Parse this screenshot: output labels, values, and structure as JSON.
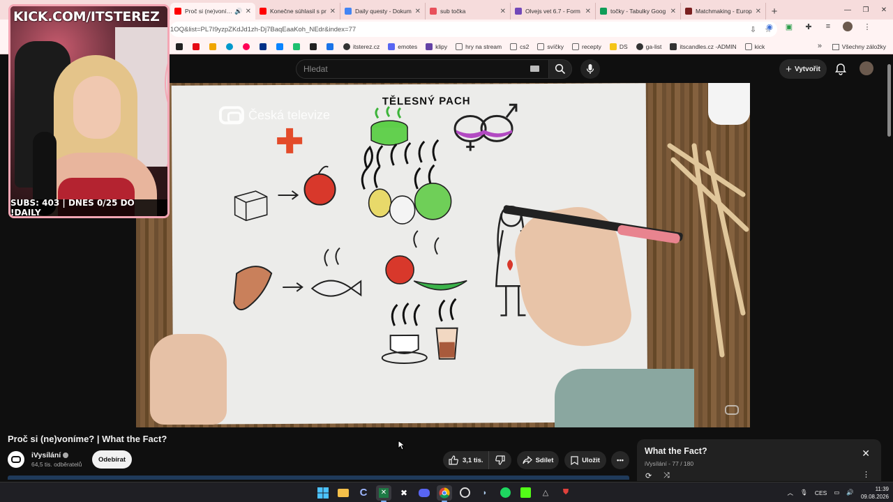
{
  "browser": {
    "tabs": [
      {
        "title": "Proč si (ne)voníme? | What the Fact?",
        "favicon_color": "#ff0000",
        "active": true
      },
      {
        "title": "Konečne súhlasil s pr",
        "favicon_color": "#ff0000"
      },
      {
        "title": "Daily questy - Dokum",
        "favicon_color": "#4285f4"
      },
      {
        "title": "sub točka",
        "favicon_color": "#e8505b"
      },
      {
        "title": "Olvejs vet 6.7 - Form",
        "favicon_color": "#7248b9"
      },
      {
        "title": "točky - Tabulky Goog",
        "favicon_color": "#0f9d58"
      },
      {
        "title": "Matchmaking - Europ",
        "favicon_color": "#7a1f1f"
      }
    ],
    "url": "1OQ&list=PL7I9yzpZKdJd1zh-Dj7BaqEaaKoh_NEdr&index=77",
    "bookmarks": [
      {
        "label": "",
        "color": "#222"
      },
      {
        "label": "",
        "color": "#e50914"
      },
      {
        "label": "",
        "color": "#f0a500"
      },
      {
        "label": "",
        "color": "#0099cc"
      },
      {
        "label": "",
        "color": "#ff0055"
      },
      {
        "label": "",
        "color": "#003087"
      },
      {
        "label": "",
        "color": "#0a84ff"
      },
      {
        "label": "",
        "color": "#1ec06f"
      },
      {
        "label": "",
        "color": "#222"
      },
      {
        "label": "",
        "color": "#1a73e8"
      },
      {
        "label": "itsterez.cz",
        "color": "#333"
      },
      {
        "label": "emotes",
        "color": "#5865f2"
      },
      {
        "label": "klipy",
        "color": "#6441a5"
      },
      {
        "label": "hry na stream",
        "color": "#888"
      },
      {
        "label": "cs2",
        "color": "#888"
      },
      {
        "label": "svíčky",
        "color": "#888"
      },
      {
        "label": "recepty",
        "color": "#888"
      },
      {
        "label": "DS",
        "color": "#f5c518"
      },
      {
        "label": "ga-list",
        "color": "#333"
      },
      {
        "label": "itscandles.cz -ADMIN",
        "color": "#333"
      },
      {
        "label": "kick",
        "color": "#888"
      }
    ],
    "bookmarks_all": "Všechny záložky"
  },
  "youtube": {
    "search_placeholder": "Hledat",
    "create_label": "Vytvořit",
    "video": {
      "title": "Proč si (ne)voníme? | What the Fact?",
      "overlay_logo": "Česká televize",
      "drawing_heading": "TĚLESNÝ PACH"
    },
    "channel": {
      "name": "iVysílání",
      "subscribers": "64,5 tis. odběratelů",
      "subscribe_label": "Odebírat"
    },
    "actions": {
      "likes": "3,1 tis.",
      "share": "Sdílet",
      "save": "Uložit"
    },
    "playlist": {
      "title": "What the Fact?",
      "channel": "iVysílání",
      "position": "77 / 180"
    }
  },
  "stream_overlay": {
    "brand": "KICK.COM/ITSTEREZ",
    "subs_bar": "SUBS: 403 | DNES 0/25 DO !DAILY"
  },
  "taskbar": {
    "lang": "CES",
    "time": "11:39",
    "date": "09.08.2026"
  }
}
